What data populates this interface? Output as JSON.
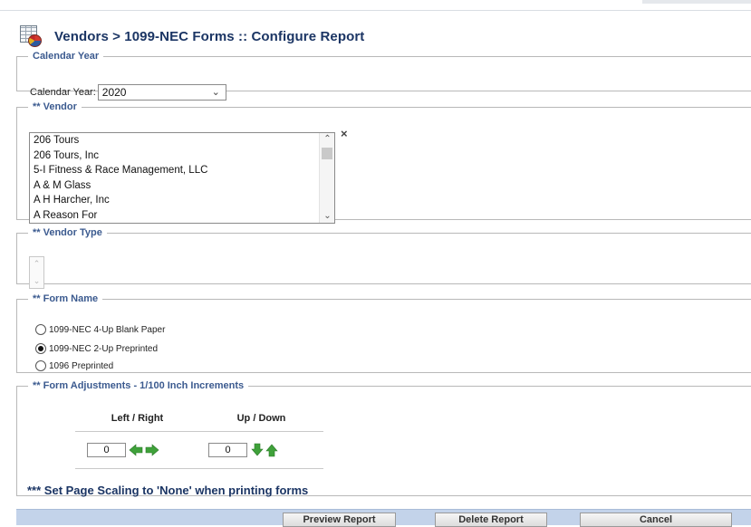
{
  "header": {
    "title": "Vendors > 1099-NEC Forms :: Configure Report"
  },
  "calendar_year": {
    "legend": "Calendar Year",
    "label": "Calendar Year:",
    "selected": "2020"
  },
  "vendor": {
    "legend": "** Vendor",
    "items": [
      "206 Tours",
      "206 Tours, Inc",
      "5-I Fitness & Race Management, LLC",
      "A & M Glass",
      "A H Harcher, Inc",
      "A Reason For"
    ],
    "clear_symbol": "×"
  },
  "vendor_type": {
    "legend": "** Vendor Type"
  },
  "form_name": {
    "legend": "** Form Name",
    "options": [
      {
        "label": "1099-NEC 4-Up Blank Paper",
        "selected": false
      },
      {
        "label": "1099-NEC 2-Up Preprinted",
        "selected": true
      },
      {
        "label": "1096 Preprinted",
        "selected": false
      }
    ]
  },
  "form_adjustments": {
    "legend": "** Form Adjustments - 1/100 Inch Increments",
    "col_left_right": "Left / Right",
    "col_up_down": "Up / Down",
    "left_right_value": "0",
    "up_down_value": "0",
    "note": "*** Set Page Scaling to 'None' when printing forms"
  },
  "footer": {
    "preview_label": "Preview Report",
    "delete_label": "Delete Report",
    "cancel_label": "Cancel"
  },
  "colors": {
    "title": "#1b3564",
    "legend": "#3b5a8f",
    "footer_bar": "#c3d3ea",
    "arrow_green": "#3fa13a"
  }
}
